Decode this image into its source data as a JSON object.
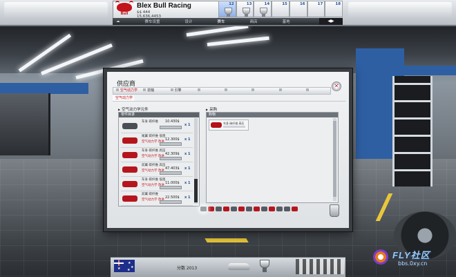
{
  "team": {
    "logo_text": "Bull",
    "name": "Blex Bull Racing",
    "stat_1": "$$ 444",
    "stat_2": "15,636,4453"
  },
  "race_strip": {
    "rounds": [
      "12",
      "13",
      "14",
      "15",
      "16",
      "17",
      "18"
    ],
    "active": "12"
  },
  "nav": {
    "left_icon": "☁",
    "items": [
      "赛车设置",
      "设计",
      "赛车",
      "商店",
      "基地"
    ],
    "right": "◀▶"
  },
  "dialog": {
    "title": "供应商",
    "close_label": "✕",
    "tabs": [
      "空气动力学",
      "前轴",
      "引擎",
      "",
      "",
      "",
      "",
      ""
    ],
    "subtabs": [
      "空气动力学",
      "",
      "",
      "",
      "",
      "",
      "",
      "",
      "",
      "",
      ""
    ],
    "list": {
      "title": "空气动力学元件",
      "header": "零件目录",
      "items": [
        {
          "name": "车身 碳纤维",
          "price": "10.430$",
          "sub": "",
          "qty": "x 1"
        },
        {
          "name": "尾翼 碳纤维 低阻",
          "price": "12.300$",
          "sub": "空气动力学 改进",
          "qty": "x 1"
        },
        {
          "name": "车身 碳纤维 高压",
          "price": "42.309$",
          "sub": "空气动力学 改进",
          "qty": "x 1"
        },
        {
          "name": "前翼 碳纤维 高压",
          "price": "47.403$",
          "sub": "空气动力学 改进",
          "qty": "x 1"
        },
        {
          "name": "车身 碳纤维 低阻",
          "price": "11.000$",
          "sub": "空气动力学 改进",
          "qty": "x 1"
        },
        {
          "name": "前翼 碳纤维",
          "price": "22.500$",
          "sub": "空气动力学 改进",
          "qty": "x 1"
        }
      ]
    },
    "cart": {
      "title": "采购",
      "header": "购物",
      "item_label": "车身 碳纤维 高压"
    }
  },
  "bottom": {
    "text": "分数 2013"
  },
  "watermark": {
    "text": "FLY社区",
    "url": "bbs.0xy.cn"
  },
  "colors": {
    "accent_red": "#c4141b",
    "accent_blue": "#1f4f99",
    "frame": "#3a3e43"
  }
}
